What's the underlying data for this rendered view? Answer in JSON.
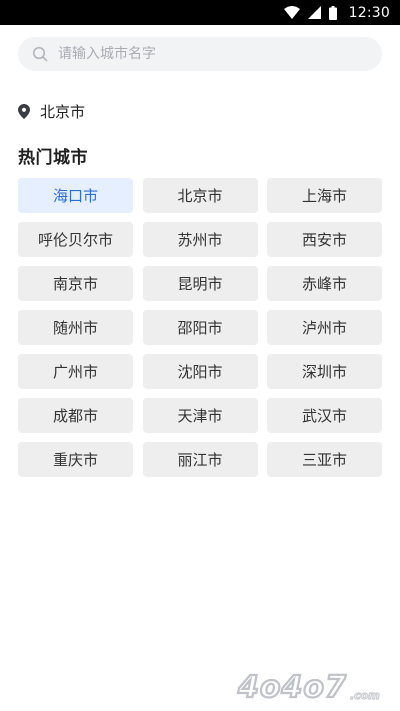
{
  "status_bar": {
    "time": "12:30",
    "icons": [
      "wifi-icon",
      "signal-icon",
      "battery-icon"
    ]
  },
  "search": {
    "placeholder": "请输入城市名字",
    "value": ""
  },
  "current_location": {
    "city": "北京市"
  },
  "hot_cities": {
    "title": "热门城市",
    "selected": "海口市",
    "items": [
      {
        "label": "海口市"
      },
      {
        "label": "北京市"
      },
      {
        "label": "上海市"
      },
      {
        "label": "呼伦贝尔市"
      },
      {
        "label": "苏州市"
      },
      {
        "label": "西安市"
      },
      {
        "label": "南京市"
      },
      {
        "label": "昆明市"
      },
      {
        "label": "赤峰市"
      },
      {
        "label": "随州市"
      },
      {
        "label": "邵阳市"
      },
      {
        "label": "泸州市"
      },
      {
        "label": "广州市"
      },
      {
        "label": "沈阳市"
      },
      {
        "label": "深圳市"
      },
      {
        "label": "成都市"
      },
      {
        "label": "天津市"
      },
      {
        "label": "武汉市"
      },
      {
        "label": "重庆市"
      },
      {
        "label": "丽江市"
      },
      {
        "label": "三亚市"
      }
    ]
  },
  "logo": {
    "text": "4o4o7.com"
  },
  "colors": {
    "accent": "#2a6fd6",
    "selected_bg": "#e6efff",
    "button_bg": "#eeeeef",
    "search_bg": "#f2f3f5"
  }
}
